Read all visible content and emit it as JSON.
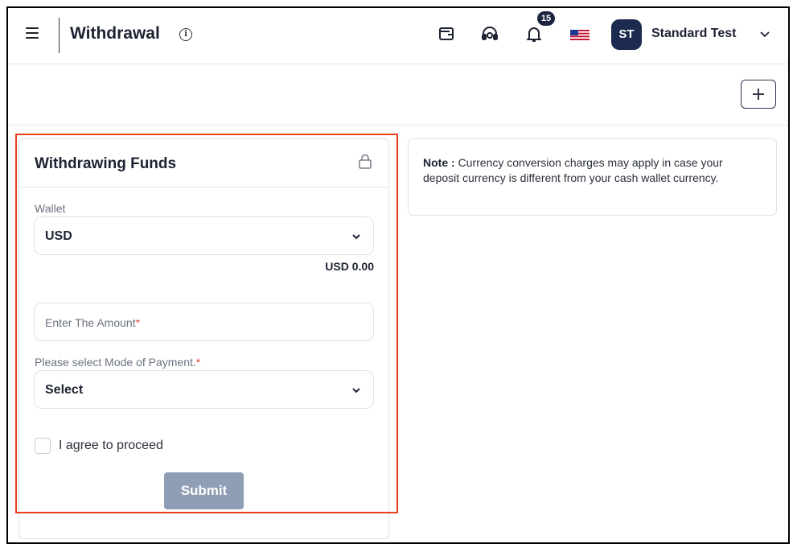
{
  "header": {
    "title": "Withdrawal",
    "info_glyph": "i",
    "notification_count": "15",
    "user_initials": "ST",
    "user_name": "Standard Test",
    "icons": [
      "menu-icon",
      "info-icon",
      "wallet-icon",
      "headset-icon",
      "bell-icon",
      "us-flag-icon",
      "chevron-down-icon"
    ]
  },
  "toolbar": {
    "add_label": "+"
  },
  "withdraw_form": {
    "title": "Withdrawing Funds",
    "wallet_label": "Wallet",
    "wallet_value": "USD",
    "balance": "USD 0.00",
    "amount_placeholder": "Enter The Amount",
    "required_mark": "*",
    "payment_label": "Please select Mode of Payment.",
    "payment_value": "Select",
    "agree_label": "I agree to proceed",
    "agree_checked": false,
    "submit_label": "Submit"
  },
  "note": {
    "label": "Note :",
    "text": " Currency conversion charges may apply in case your deposit currency is different from your cash wallet currency."
  },
  "colors": {
    "highlight": "#e8401c",
    "navy": "#1c2a4f",
    "submit_disabled": "#8f9db5",
    "required": "#e44c3a"
  }
}
